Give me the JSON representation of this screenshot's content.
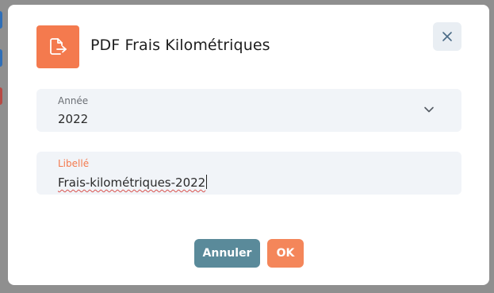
{
  "dialog": {
    "title": "PDF Frais Kilométriques",
    "header_icon": "file-export-icon",
    "close_icon": "close-icon"
  },
  "fields": {
    "year": {
      "label": "Année",
      "value": "2022",
      "icon": "chevron-down-icon"
    },
    "libelle": {
      "label": "Libellé",
      "value": "Frais-kilométriques-2022"
    }
  },
  "buttons": {
    "cancel": "Annuler",
    "ok": "OK"
  },
  "colors": {
    "accent": "#f47a4e",
    "cancel_button": "#5a8a9a",
    "ok_button": "#f4865a",
    "field_bg": "#f1f4f8"
  }
}
